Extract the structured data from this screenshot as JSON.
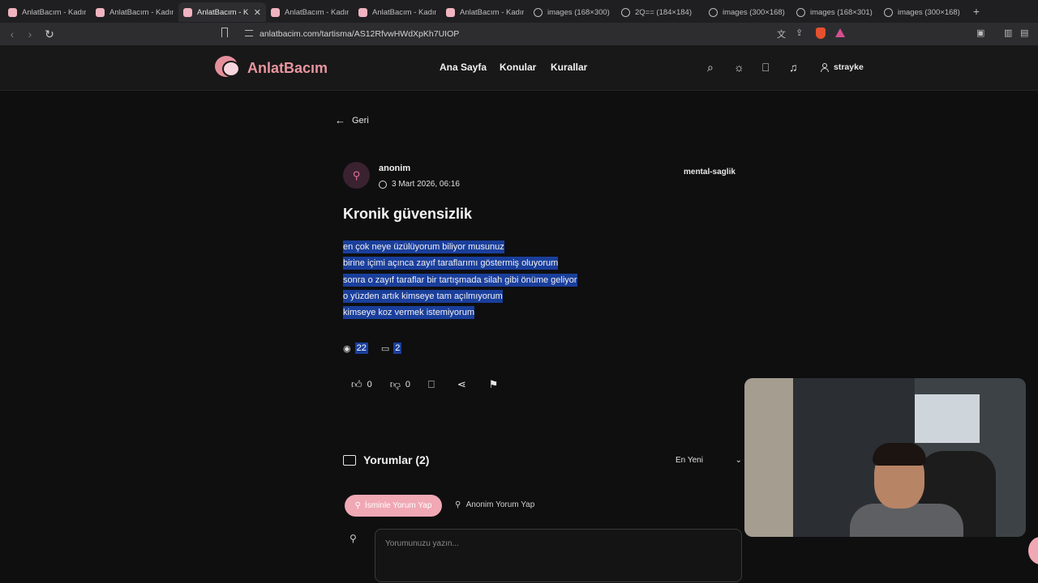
{
  "browser": {
    "tabs": [
      {
        "label": "AnlatBacım - Kadın",
        "icon": "site-favicon"
      },
      {
        "label": "AnlatBacım - Kadın",
        "icon": "site-favicon"
      },
      {
        "label": "AnlatBacım - K",
        "icon": "site-favicon",
        "active": true
      },
      {
        "label": "AnlatBacım - Kadın",
        "icon": "site-favicon"
      },
      {
        "label": "AnlatBacım - Kadın",
        "icon": "site-favicon"
      },
      {
        "label": "AnlatBacım - Kadın",
        "icon": "site-favicon"
      },
      {
        "label": "images (168×300)",
        "icon": "globe-icon"
      },
      {
        "label": "2Q== (184×184)",
        "icon": "globe-icon"
      },
      {
        "label": "images (300×168)",
        "icon": "globe-icon"
      },
      {
        "label": "images (168×301)",
        "icon": "globe-icon"
      },
      {
        "label": "images (300×168)",
        "icon": "globe-icon"
      }
    ],
    "new_tab": "+",
    "url": "anlatbacim.com/tartisma/AS12RfvwHWdXpKh7UIOP"
  },
  "site": {
    "logo": "AnlatBacım",
    "nav": [
      "Ana Sayfa",
      "Konular",
      "Kurallar"
    ],
    "username": "strayke",
    "brand_color": "#e8959f"
  },
  "post": {
    "back_label": "Geri",
    "author": "anonim",
    "date": "3 Mart 2026, 06:16",
    "category": "mental-saglik",
    "title": "Kronik güvensizlik",
    "body_lines": [
      "en çok neye üzülüyorum biliyor musunuz",
      "birine içimi açınca zayıf taraflarımı göstermiş oluyorum",
      "sonra o zayıf taraflar bir tartışmada silah gibi önüme geliyor",
      "o yüzden artık kimseye tam açılmıyorum",
      "kimseye koz vermek istemiyorum"
    ],
    "views": "22",
    "comments_count": "2",
    "likes": "0",
    "dislikes": "0"
  },
  "comments": {
    "title": "Yorumlar (2)",
    "sort": "En Yeni",
    "named_button": "İsminle Yorum Yap",
    "anon_button": "Anonim Yorum Yap",
    "placeholder": "Yorumunuzu yazın..."
  }
}
